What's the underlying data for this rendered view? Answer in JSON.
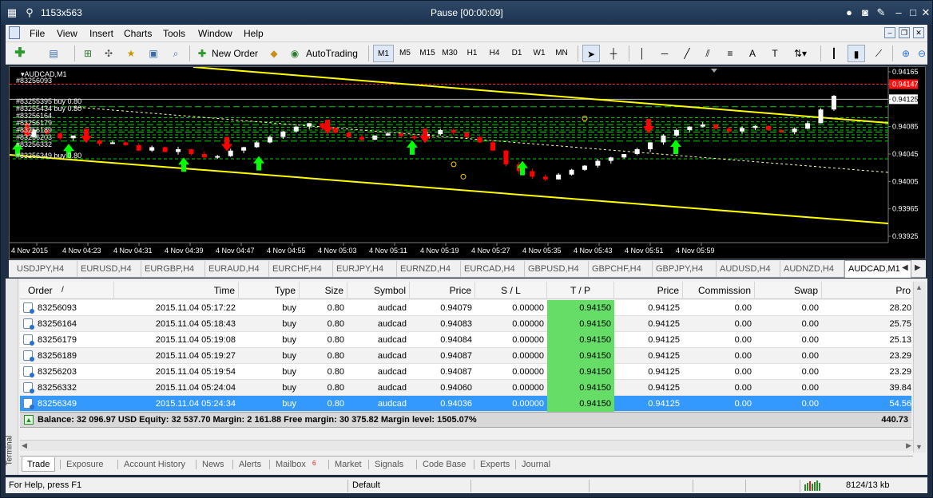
{
  "window": {
    "title": "1153x563",
    "center_title": "Pause [00:00:09]"
  },
  "menu": [
    "File",
    "View",
    "Insert",
    "Charts",
    "Tools",
    "Window",
    "Help"
  ],
  "toolbar": {
    "new_order": "New Order",
    "auto_trading": "AutoTrading",
    "timeframes": [
      "M1",
      "M5",
      "M15",
      "M30",
      "H1",
      "H4",
      "D1",
      "W1",
      "MN"
    ]
  },
  "chart": {
    "symbol_label": "AUDCAD,M1",
    "order_labels": [
      "#83256093",
      "#83255395 buy 0.80",
      "#83255434 buy 0.80",
      "#83256164",
      "#83256179",
      "#83256189",
      "#83256203",
      "#83256332",
      "#83256349 buy 0.80"
    ],
    "price_labels": [
      "0.94165",
      "0.94147",
      "0.94125",
      "0.94085",
      "0.94045",
      "0.94005",
      "0.93965",
      "0.93925"
    ],
    "time_labels": [
      "4 Nov 2015",
      "4 Nov 04:23",
      "4 Nov 04:31",
      "4 Nov 04:39",
      "4 Nov 04:47",
      "4 Nov 04:55",
      "4 Nov 05:03",
      "4 Nov 05:11",
      "4 Nov 05:19",
      "4 Nov 05:27",
      "4 Nov 05:35",
      "4 Nov 05:43",
      "4 Nov 05:51",
      "4 Nov 05:59"
    ],
    "colors": {
      "bg": "#000000",
      "bull": "#ffffff",
      "bear": "#ff0000",
      "channel": "#ffff00",
      "levels": "#00cc00",
      "arrow_up": "#00ff00",
      "arrow_down": "#ff0000"
    }
  },
  "chart_tabs": [
    "USDJPY,H4",
    "EURUSD,H4",
    "EURGBP,H4",
    "EURAUD,H4",
    "EURCHF,H4",
    "EURJPY,H4",
    "EURNZD,H4",
    "EURCAD,H4",
    "GBPUSD,H4",
    "GBPCHF,H4",
    "GBPJPY,H4",
    "AUDUSD,H4",
    "AUDNZD,H4",
    "AUDCAD,M1"
  ],
  "columns": [
    "Order",
    "/",
    "Time",
    "Type",
    "Size",
    "Symbol",
    "Price",
    "S / L",
    "T / P",
    "Price",
    "Commission",
    "Swap",
    "Pro"
  ],
  "orders": [
    {
      "order": "83256093",
      "time": "2015.11.04 05:17:22",
      "type": "buy",
      "size": "0.80",
      "symbol": "audcad",
      "price": "0.94079",
      "sl": "0.00000",
      "tp": "0.94150",
      "cur": "0.94125",
      "comm": "0.00",
      "swap": "0.00",
      "profit": "28.20"
    },
    {
      "order": "83256164",
      "time": "2015.11.04 05:18:43",
      "type": "buy",
      "size": "0.80",
      "symbol": "audcad",
      "price": "0.94083",
      "sl": "0.00000",
      "tp": "0.94150",
      "cur": "0.94125",
      "comm": "0.00",
      "swap": "0.00",
      "profit": "25.75"
    },
    {
      "order": "83256179",
      "time": "2015.11.04 05:19:08",
      "type": "buy",
      "size": "0.80",
      "symbol": "audcad",
      "price": "0.94084",
      "sl": "0.00000",
      "tp": "0.94150",
      "cur": "0.94125",
      "comm": "0.00",
      "swap": "0.00",
      "profit": "25.13"
    },
    {
      "order": "83256189",
      "time": "2015.11.04 05:19:27",
      "type": "buy",
      "size": "0.80",
      "symbol": "audcad",
      "price": "0.94087",
      "sl": "0.00000",
      "tp": "0.94150",
      "cur": "0.94125",
      "comm": "0.00",
      "swap": "0.00",
      "profit": "23.29"
    },
    {
      "order": "83256203",
      "time": "2015.11.04 05:19:54",
      "type": "buy",
      "size": "0.80",
      "symbol": "audcad",
      "price": "0.94087",
      "sl": "0.00000",
      "tp": "0.94150",
      "cur": "0.94125",
      "comm": "0.00",
      "swap": "0.00",
      "profit": "23.29"
    },
    {
      "order": "83256332",
      "time": "2015.11.04 05:24:04",
      "type": "buy",
      "size": "0.80",
      "symbol": "audcad",
      "price": "0.94060",
      "sl": "0.00000",
      "tp": "0.94150",
      "cur": "0.94125",
      "comm": "0.00",
      "swap": "0.00",
      "profit": "39.84"
    },
    {
      "order": "83256349",
      "time": "2015.11.04 05:24:34",
      "type": "buy",
      "size": "0.80",
      "symbol": "audcad",
      "price": "0.94036",
      "sl": "0.00000",
      "tp": "0.94150",
      "cur": "0.94125",
      "comm": "0.00",
      "swap": "0.00",
      "profit": "54.56"
    }
  ],
  "balance": {
    "text": "Balance: 32 096.97 USD  Equity: 32 537.70  Margin: 2 161.88  Free margin: 30 375.82  Margin level: 1505.07%",
    "total": "440.73"
  },
  "terminal_label": "Terminal",
  "terminal_tabs": [
    "Trade",
    "Exposure",
    "Account History",
    "News",
    "Alerts",
    "Mailbox",
    "Market",
    "Signals",
    "Code Base",
    "Experts",
    "Journal"
  ],
  "mailbox_badge": "6",
  "status": {
    "help": "For Help, press F1",
    "profile": "Default",
    "traffic": "8124/13 kb"
  }
}
